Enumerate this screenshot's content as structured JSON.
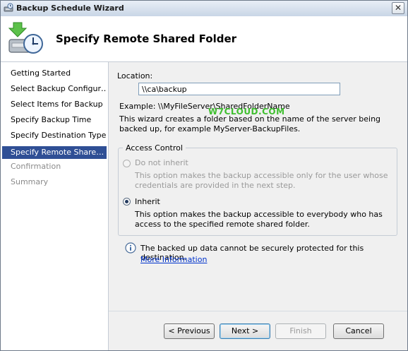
{
  "window": {
    "title": "Backup Schedule Wizard",
    "close_glyph": "✕"
  },
  "header": {
    "title": "Specify Remote Shared Folder"
  },
  "nav": {
    "items": [
      {
        "label": "Getting Started",
        "state": "normal"
      },
      {
        "label": "Select Backup Configur…",
        "state": "normal"
      },
      {
        "label": "Select Items for Backup",
        "state": "normal"
      },
      {
        "label": "Specify Backup Time",
        "state": "normal"
      },
      {
        "label": "Specify Destination Type",
        "state": "normal"
      },
      {
        "label": "Specify Remote Share…",
        "state": "active"
      },
      {
        "label": "Confirmation",
        "state": "disabled"
      },
      {
        "label": "Summary",
        "state": "disabled"
      }
    ]
  },
  "location": {
    "label": "Location:",
    "value": "\\\\ca\\backup",
    "example": "Example: \\\\MyFileServer\\SharedFolderName",
    "description": "This wizard creates a folder based on the name of the server being backed up, for example MyServer-BackupFiles."
  },
  "watermark": "W7CLOUD.COM",
  "access_control": {
    "legend": "Access Control",
    "options": [
      {
        "label": "Do not inherit",
        "description": "This option makes the backup accessible only for the user whose credentials are provided in the next step.",
        "selected": false,
        "enabled": false
      },
      {
        "label": "Inherit",
        "description": "This option makes the backup accessible to everybody who has access to the specified remote shared folder.",
        "selected": true,
        "enabled": true
      }
    ]
  },
  "info": {
    "icon": "info-icon",
    "text": "The backed up data cannot be securely protected for this destination.",
    "link": "More Information"
  },
  "buttons": {
    "previous": "< Previous",
    "next": "Next >",
    "finish": "Finish",
    "cancel": "Cancel"
  }
}
